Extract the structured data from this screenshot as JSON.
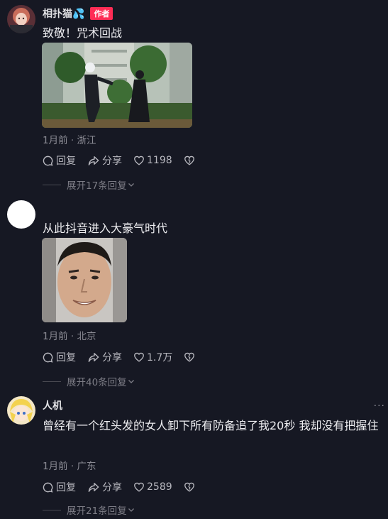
{
  "comments": [
    {
      "name": "相扑猫💦",
      "badge": "作者",
      "text": "致敬！咒术回战",
      "meta": "1月前 · 浙江",
      "reply": "回复",
      "share": "分享",
      "likes": "1198",
      "expand": "展开17条回复"
    },
    {
      "name": "",
      "text": "从此抖音进入大豪气时代",
      "meta": "1月前 · 北京",
      "reply": "回复",
      "share": "分享",
      "likes": "1.7万",
      "expand": "展开40条回复"
    },
    {
      "name": "人机",
      "text": "曾经有一个红头发的女人卸下所有防备追了我20秒 我却没有把握住",
      "meta": "1月前 · 广东",
      "reply": "回复",
      "share": "分享",
      "likes": "2589",
      "expand": "展开21条回复",
      "more": "···"
    }
  ],
  "icons": {
    "reply": "reply-bubble-icon",
    "share": "share-arrow-icon",
    "like": "heart-icon",
    "dislike": "broken-heart-icon",
    "expand": "chevron-down-icon"
  },
  "colors": {
    "background": "#161823",
    "badge": "#fe2c55",
    "meta": "#8b8b94"
  }
}
